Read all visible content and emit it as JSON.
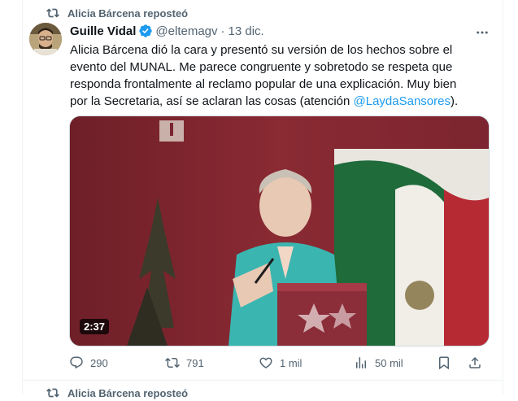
{
  "repost_banner": {
    "text": "Alicia Bárcena reposteó"
  },
  "tweet": {
    "author_name": "Guille Vidal",
    "handle": "@eltemagv",
    "separator": "·",
    "time": "13 dic.",
    "body_lines": [
      "Alicia Bárcena dió la cara y presentó su versión de los hechos sobre el",
      "evento del MUNAL. Me parece congruente y sobretodo se respeta que",
      "responda frontalmente al reclamo popular de una explicación. Muy bien"
    ],
    "body_last_prefix": "por la Secretaria, así se aclaran las cosas (atención ",
    "mention": "@LaydaSansores",
    "body_last_suffix": ").",
    "video": {
      "duration": "2:37"
    },
    "actions": {
      "replies": "290",
      "reposts": "791",
      "likes": "1 mil",
      "views": "50 mil"
    }
  },
  "next_repost_banner": {
    "text": "Alicia Bárcena reposteó"
  },
  "colors": {
    "text": "#0f1419",
    "secondary": "#536471",
    "link": "#1d9bf0",
    "repost_active": "#536471",
    "border": "#eff3f4"
  }
}
